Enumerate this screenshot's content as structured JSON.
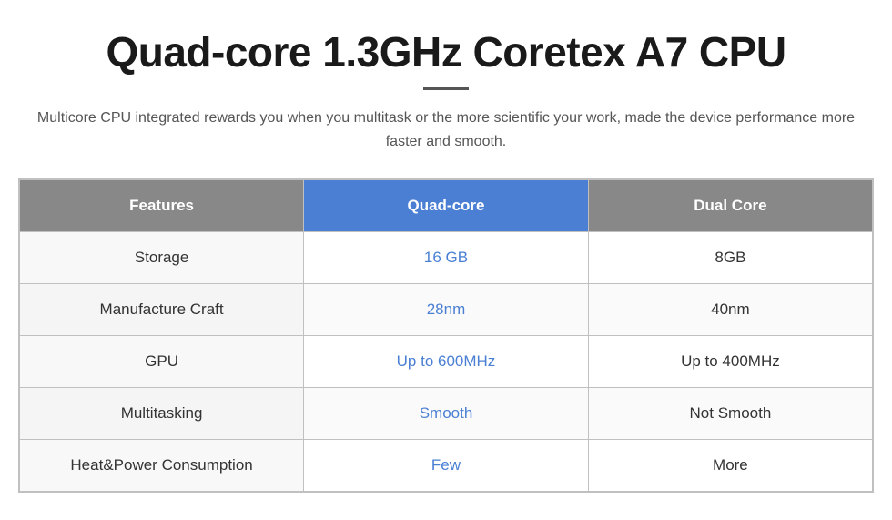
{
  "page": {
    "title": "Quad-core 1.3GHz Coretex A7 CPU",
    "subtitle": "Multicore CPU integrated rewards you when you multitask or the more scientific your work, made the device performance more faster and smooth.",
    "table": {
      "headers": {
        "features": "Features",
        "quadcore": "Quad-core",
        "dualcore": "Dual Core"
      },
      "rows": [
        {
          "feature": "Storage",
          "quad_value": "16 GB",
          "dual_value": "8GB"
        },
        {
          "feature": "Manufacture Craft",
          "quad_value": "28nm",
          "dual_value": "40nm"
        },
        {
          "feature": "GPU",
          "quad_value": "Up to 600MHz",
          "dual_value": "Up to 400MHz"
        },
        {
          "feature": "Multitasking",
          "quad_value": "Smooth",
          "dual_value": "Not Smooth"
        },
        {
          "feature": "Heat&Power Consumption",
          "quad_value": "Few",
          "dual_value": "More"
        }
      ]
    }
  }
}
